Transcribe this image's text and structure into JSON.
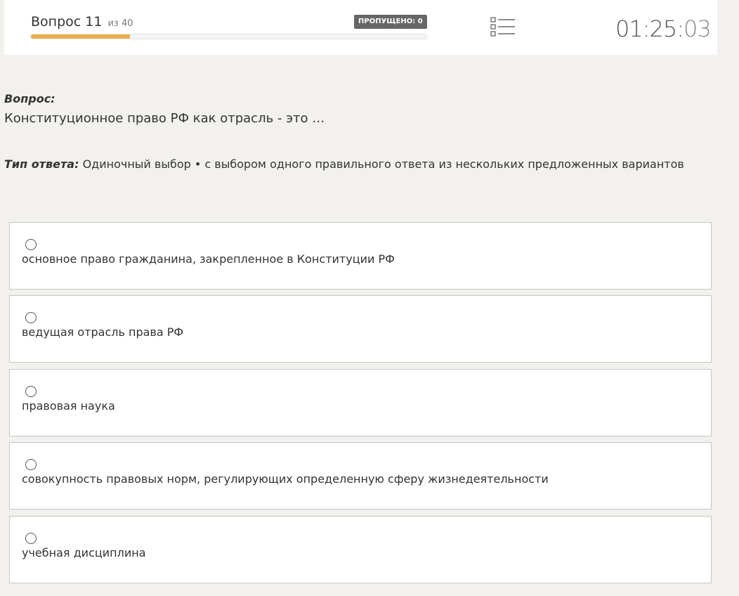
{
  "header": {
    "question_label": "Вопрос 11",
    "question_total": "из 40",
    "progress_fraction": 0.25,
    "progress_color": "#e7b04c",
    "skipped_badge": "ПРОПУЩЕНО: 0",
    "list_icon": "question-list-icon",
    "timer": {
      "main": "01:25:",
      "seconds": "03"
    }
  },
  "question": {
    "label": "Вопрос:",
    "text": "Конституционное право РФ как отрасль - это …"
  },
  "answer_type": {
    "label": "Тип ответа:",
    "value": "Одиночный выбор • с выбором одного правильного ответа из нескольких предложенных вариантов"
  },
  "options": [
    {
      "text": "основное право гражданина, закрепленное в Конституции РФ",
      "selected": false
    },
    {
      "text": "ведущая отрасль права РФ",
      "selected": false
    },
    {
      "text": "правовая наука",
      "selected": false
    },
    {
      "text": "совокупность правовых норм, регулирующих определенную сферу жизнедеятельности",
      "selected": false
    },
    {
      "text": "учебная дисциплина",
      "selected": false
    }
  ]
}
